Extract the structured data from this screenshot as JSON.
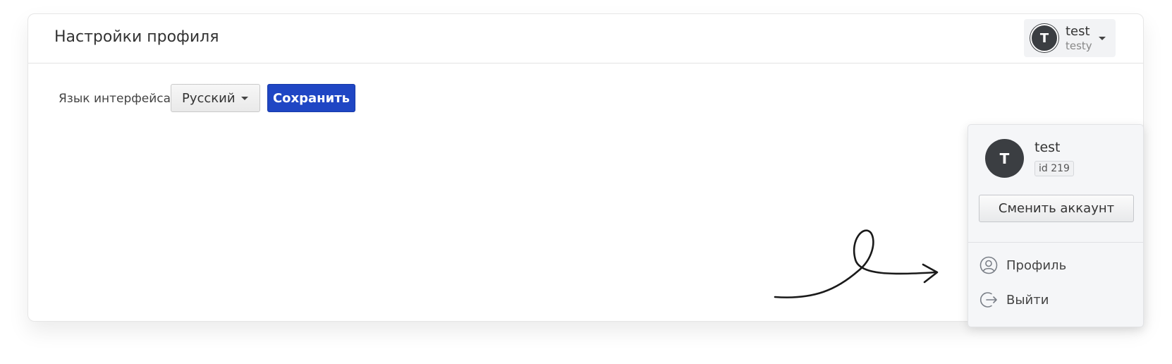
{
  "header": {
    "title": "Настройки профиля"
  },
  "user": {
    "initial": "T",
    "name": "test",
    "login": "testy",
    "id_label": "id 219"
  },
  "settings": {
    "language_label": "Язык интерфейса",
    "language_value": "Русский",
    "save_label": "Сохранить"
  },
  "dropdown": {
    "switch_label": "Сменить аккаунт",
    "items": [
      {
        "label": "Профиль",
        "icon": "user-circle-icon"
      },
      {
        "label": "Выйти",
        "icon": "logout-icon"
      }
    ]
  },
  "colors": {
    "primary": "#1f46c4",
    "avatar": "#3b3e42"
  }
}
